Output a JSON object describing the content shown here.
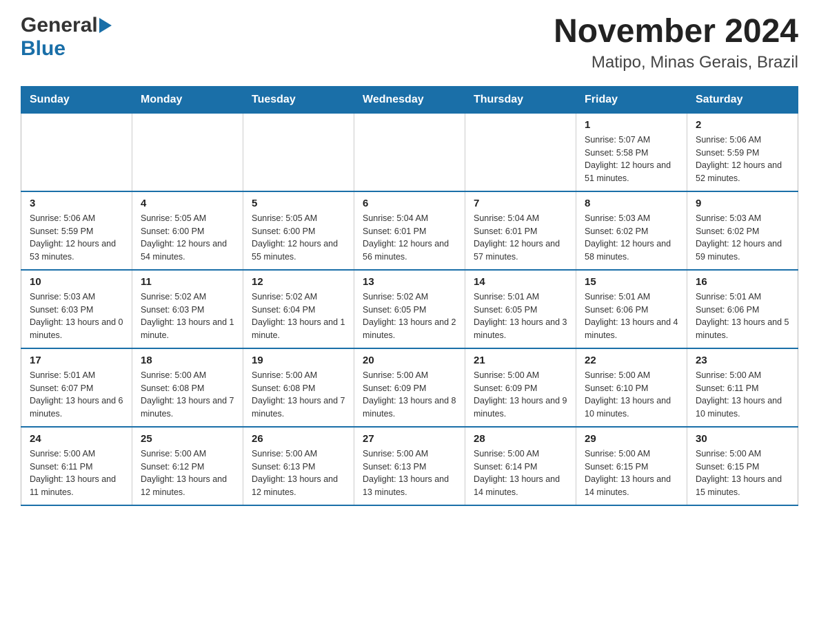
{
  "header": {
    "logo": {
      "general": "General",
      "blue": "Blue"
    },
    "title": "November 2024",
    "subtitle": "Matipo, Minas Gerais, Brazil"
  },
  "calendar": {
    "weekdays": [
      "Sunday",
      "Monday",
      "Tuesday",
      "Wednesday",
      "Thursday",
      "Friday",
      "Saturday"
    ],
    "weeks": [
      [
        {
          "day": "",
          "info": ""
        },
        {
          "day": "",
          "info": ""
        },
        {
          "day": "",
          "info": ""
        },
        {
          "day": "",
          "info": ""
        },
        {
          "day": "",
          "info": ""
        },
        {
          "day": "1",
          "info": "Sunrise: 5:07 AM\nSunset: 5:58 PM\nDaylight: 12 hours and 51 minutes."
        },
        {
          "day": "2",
          "info": "Sunrise: 5:06 AM\nSunset: 5:59 PM\nDaylight: 12 hours and 52 minutes."
        }
      ],
      [
        {
          "day": "3",
          "info": "Sunrise: 5:06 AM\nSunset: 5:59 PM\nDaylight: 12 hours and 53 minutes."
        },
        {
          "day": "4",
          "info": "Sunrise: 5:05 AM\nSunset: 6:00 PM\nDaylight: 12 hours and 54 minutes."
        },
        {
          "day": "5",
          "info": "Sunrise: 5:05 AM\nSunset: 6:00 PM\nDaylight: 12 hours and 55 minutes."
        },
        {
          "day": "6",
          "info": "Sunrise: 5:04 AM\nSunset: 6:01 PM\nDaylight: 12 hours and 56 minutes."
        },
        {
          "day": "7",
          "info": "Sunrise: 5:04 AM\nSunset: 6:01 PM\nDaylight: 12 hours and 57 minutes."
        },
        {
          "day": "8",
          "info": "Sunrise: 5:03 AM\nSunset: 6:02 PM\nDaylight: 12 hours and 58 minutes."
        },
        {
          "day": "9",
          "info": "Sunrise: 5:03 AM\nSunset: 6:02 PM\nDaylight: 12 hours and 59 minutes."
        }
      ],
      [
        {
          "day": "10",
          "info": "Sunrise: 5:03 AM\nSunset: 6:03 PM\nDaylight: 13 hours and 0 minutes."
        },
        {
          "day": "11",
          "info": "Sunrise: 5:02 AM\nSunset: 6:03 PM\nDaylight: 13 hours and 1 minute."
        },
        {
          "day": "12",
          "info": "Sunrise: 5:02 AM\nSunset: 6:04 PM\nDaylight: 13 hours and 1 minute."
        },
        {
          "day": "13",
          "info": "Sunrise: 5:02 AM\nSunset: 6:05 PM\nDaylight: 13 hours and 2 minutes."
        },
        {
          "day": "14",
          "info": "Sunrise: 5:01 AM\nSunset: 6:05 PM\nDaylight: 13 hours and 3 minutes."
        },
        {
          "day": "15",
          "info": "Sunrise: 5:01 AM\nSunset: 6:06 PM\nDaylight: 13 hours and 4 minutes."
        },
        {
          "day": "16",
          "info": "Sunrise: 5:01 AM\nSunset: 6:06 PM\nDaylight: 13 hours and 5 minutes."
        }
      ],
      [
        {
          "day": "17",
          "info": "Sunrise: 5:01 AM\nSunset: 6:07 PM\nDaylight: 13 hours and 6 minutes."
        },
        {
          "day": "18",
          "info": "Sunrise: 5:00 AM\nSunset: 6:08 PM\nDaylight: 13 hours and 7 minutes."
        },
        {
          "day": "19",
          "info": "Sunrise: 5:00 AM\nSunset: 6:08 PM\nDaylight: 13 hours and 7 minutes."
        },
        {
          "day": "20",
          "info": "Sunrise: 5:00 AM\nSunset: 6:09 PM\nDaylight: 13 hours and 8 minutes."
        },
        {
          "day": "21",
          "info": "Sunrise: 5:00 AM\nSunset: 6:09 PM\nDaylight: 13 hours and 9 minutes."
        },
        {
          "day": "22",
          "info": "Sunrise: 5:00 AM\nSunset: 6:10 PM\nDaylight: 13 hours and 10 minutes."
        },
        {
          "day": "23",
          "info": "Sunrise: 5:00 AM\nSunset: 6:11 PM\nDaylight: 13 hours and 10 minutes."
        }
      ],
      [
        {
          "day": "24",
          "info": "Sunrise: 5:00 AM\nSunset: 6:11 PM\nDaylight: 13 hours and 11 minutes."
        },
        {
          "day": "25",
          "info": "Sunrise: 5:00 AM\nSunset: 6:12 PM\nDaylight: 13 hours and 12 minutes."
        },
        {
          "day": "26",
          "info": "Sunrise: 5:00 AM\nSunset: 6:13 PM\nDaylight: 13 hours and 12 minutes."
        },
        {
          "day": "27",
          "info": "Sunrise: 5:00 AM\nSunset: 6:13 PM\nDaylight: 13 hours and 13 minutes."
        },
        {
          "day": "28",
          "info": "Sunrise: 5:00 AM\nSunset: 6:14 PM\nDaylight: 13 hours and 14 minutes."
        },
        {
          "day": "29",
          "info": "Sunrise: 5:00 AM\nSunset: 6:15 PM\nDaylight: 13 hours and 14 minutes."
        },
        {
          "day": "30",
          "info": "Sunrise: 5:00 AM\nSunset: 6:15 PM\nDaylight: 13 hours and 15 minutes."
        }
      ]
    ]
  }
}
